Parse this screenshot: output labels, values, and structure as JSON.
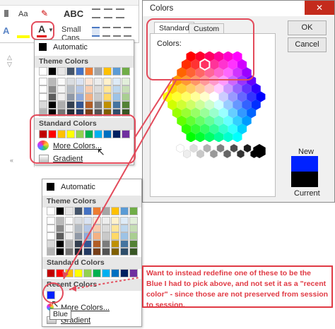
{
  "ribbon": {
    "style_label": "Aa",
    "font_color_letter": "A",
    "abc_label": "ABC",
    "small_caps_label": "Small Caps"
  },
  "top_menu": {
    "automatic_label": "Automatic",
    "theme_colors_label": "Theme Colors",
    "standard_colors_label": "Standard Colors",
    "more_colors_label": "More Colors...",
    "gradient_label": "Gradient"
  },
  "dialog": {
    "title": "Colors",
    "close_glyph": "✕",
    "tabs": [
      "Standard",
      "Custom"
    ],
    "colors_label": "Colors:",
    "ok_label": "OK",
    "cancel_label": "Cancel",
    "new_label": "New",
    "current_label": "Current",
    "new_color": "#0022ff",
    "current_color": "#000000"
  },
  "bottom_menu": {
    "automatic_label": "Automatic",
    "theme_colors_label": "Theme Colors",
    "standard_colors_label": "Standard Colors",
    "recent_colors_label": "Recent Colors",
    "more_colors_label": "More Colors...",
    "gradient_label": "Gradient",
    "tooltip": "Blue"
  },
  "annotation": "Want to instead redefine one of these to be the Blue I had to pick above, and not set it as a \"recent color\" - since those are not preserved from session to session.",
  "colors": {
    "theme_columns": [
      "#ffffff",
      "#000000",
      "#e7e6e6",
      "#44546a",
      "#4472c4",
      "#ed7d31",
      "#a5a5a5",
      "#ffc000",
      "#5b9bd5",
      "#70ad47"
    ],
    "standard": [
      "#c00000",
      "#ff0000",
      "#ffc000",
      "#ffff00",
      "#92d050",
      "#00b050",
      "#00b0f0",
      "#0070c0",
      "#002060",
      "#7030a0"
    ],
    "recent": [
      "#0022ff"
    ],
    "accent": "#e34b5b"
  }
}
